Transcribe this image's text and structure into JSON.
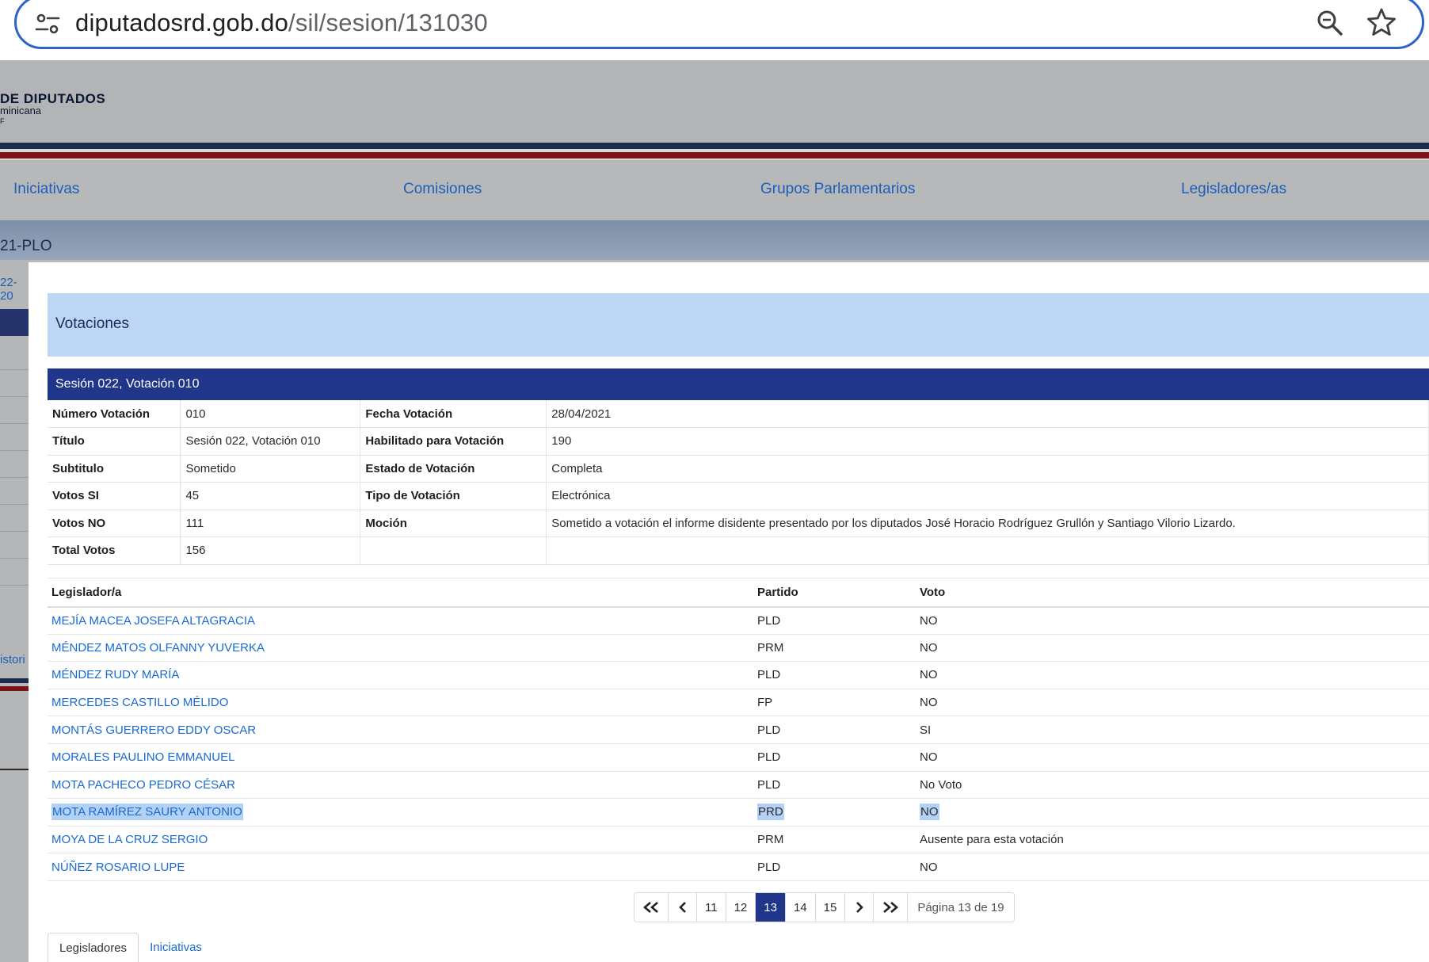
{
  "browser": {
    "url_domain": "diputadosrd.gob.do",
    "url_path": "/sil/sesion/131030"
  },
  "background_page": {
    "logo_title": "DE DIPUTADOS",
    "logo_subtitle": "minicana",
    "nav": [
      "Iniciativas",
      "Comisiones",
      "Grupos Parlamentarios",
      "Legisladores/as"
    ],
    "code_fragment": "21-PLO",
    "date_fragment": "22-20",
    "history_fragment": "istori"
  },
  "modal": {
    "section_title": "Votaciones",
    "session_title": "Sesión 022, Votación 010",
    "details": [
      {
        "label1": "Número Votación",
        "value1": "010",
        "label2": "Fecha Votación",
        "value2": "28/04/2021"
      },
      {
        "label1": "Título",
        "value1": "Sesión 022, Votación 010",
        "label2": "Habilitado para Votación",
        "value2": "190"
      },
      {
        "label1": "Subtitulo",
        "value1": "Sometido",
        "label2": "Estado de Votación",
        "value2": "Completa"
      },
      {
        "label1": "Votos SI",
        "value1": "45",
        "label2": "Tipo de Votación",
        "value2": "Electrónica"
      },
      {
        "label1": "Votos NO",
        "value1": "111",
        "label2": "Moción",
        "value2": "Sometido a votación el informe disidente presentado por los diputados José Horacio Rodríguez Grullón y Santiago Vilorio Lizardo."
      },
      {
        "label1": "Total Votos",
        "value1": "156",
        "label2": "",
        "value2": ""
      }
    ],
    "votes_headers": {
      "legislator": "Legislador/a",
      "party": "Partido",
      "vote": "Voto"
    },
    "votes": [
      {
        "name": "MEJÍA MACEA JOSEFA ALTAGRACIA",
        "party": "PLD",
        "vote": "NO"
      },
      {
        "name": "MÉNDEZ MATOS OLFANNY YUVERKA",
        "party": "PRM",
        "vote": "NO"
      },
      {
        "name": "MÉNDEZ RUDY MARÍA",
        "party": "PLD",
        "vote": "NO"
      },
      {
        "name": "MERCEDES CASTILLO MÉLIDO",
        "party": "FP",
        "vote": "NO"
      },
      {
        "name": "MONTÁS GUERRERO EDDY OSCAR",
        "party": "PLD",
        "vote": "SI"
      },
      {
        "name": "MORALES PAULINO EMMANUEL",
        "party": "PLD",
        "vote": "NO"
      },
      {
        "name": "MOTA PACHECO PEDRO CÉSAR",
        "party": "PLD",
        "vote": "No Voto"
      },
      {
        "name": "MOTA RAMÍREZ SAURY ANTONIO",
        "party": "PRD",
        "vote": "NO"
      },
      {
        "name": "MOYA DE LA CRUZ SERGIO",
        "party": "PRM",
        "vote": "Ausente para esta votación"
      },
      {
        "name": "NÚÑEZ ROSARIO LUPE",
        "party": "PLD",
        "vote": "NO"
      }
    ],
    "pagination": {
      "pages": [
        "11",
        "12",
        "13",
        "14",
        "15"
      ],
      "current": "13",
      "info": "Página 13 de 19"
    },
    "tabs": [
      "Legisladores",
      "Iniciativas"
    ]
  },
  "colors": {
    "modal_header_bg": "#bcd6f3",
    "session_header_bg": "#20368a",
    "link": "#1a6ad0",
    "selection_highlight": "#b3d1f5"
  }
}
